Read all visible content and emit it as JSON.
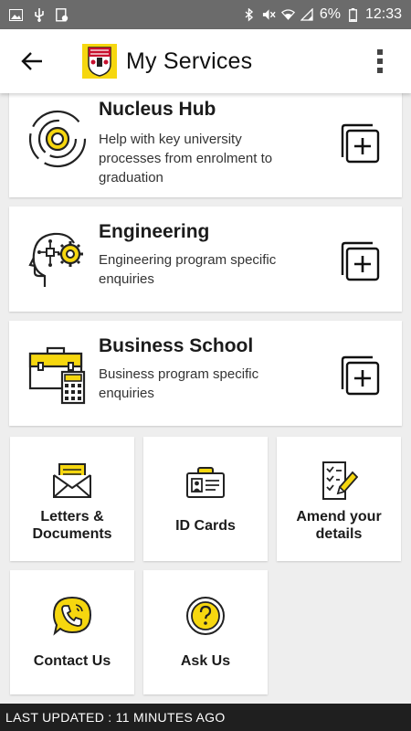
{
  "status_bar": {
    "battery": "6%",
    "time": "12:33",
    "icons": [
      "image-icon",
      "usb-icon",
      "screenshot-icon",
      "bluetooth-icon",
      "mute-icon",
      "wifi-icon",
      "signal-icon",
      "battery-icon"
    ]
  },
  "app_bar": {
    "title": "My Services",
    "back_icon": "arrow-left-icon",
    "menu_icon": "more-vertical-icon",
    "accent": "#f6d70f"
  },
  "cards": [
    {
      "title": "Nucleus Hub",
      "description": "Help with key university processes from enrolment to graduation",
      "icon": "nucleus-icon"
    },
    {
      "title": "Engineering",
      "description": "Engineering program specific enquiries",
      "icon": "engineering-head-gear-icon"
    },
    {
      "title": "Business School",
      "description": "Business program specific enquiries",
      "icon": "briefcase-calculator-icon"
    }
  ],
  "tiles": [
    {
      "label": "Letters & Documents",
      "icon": "envelope-icon"
    },
    {
      "label": "ID Cards",
      "icon": "id-card-icon"
    },
    {
      "label": "Amend your details",
      "icon": "edit-document-icon"
    },
    {
      "label": "Contact Us",
      "icon": "phone-bubble-icon"
    },
    {
      "label": "Ask Us",
      "icon": "question-icon"
    }
  ],
  "footer": {
    "last_updated": "LAST UPDATED : 11 MINUTES AGO"
  }
}
